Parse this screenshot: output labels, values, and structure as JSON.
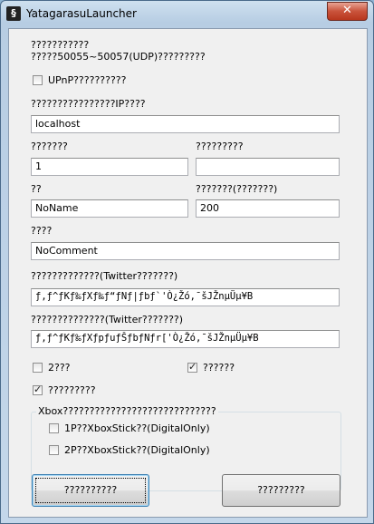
{
  "window": {
    "title": "YatagarasuLauncher",
    "close_label": "✕"
  },
  "labels": {
    "port_title": "???????????",
    "port_desc": "?????50055~50057(UDP)?????????",
    "upnp": "UPnP??????????",
    "ip_label": "????????????????IP????",
    "port_left_label": "???????",
    "port_right_label": "?????????",
    "name_label": "??",
    "delay_label": "???????(???????)",
    "comment_label": "????",
    "twitter_id_label": "?????????????(Twitter???????)",
    "twitter_pw_label": "??????????????(Twitter???????)",
    "opt1": "2???",
    "opt2": "??????",
    "opt3": "?????????",
    "xbox_group": "Xbox?????????????????????????????",
    "xbox_1p": "1P??XboxStick??(DigitalOnly)",
    "xbox_2p": "2P??XboxStick??(DigitalOnly)"
  },
  "fields": {
    "ip": "localhost",
    "port_left": "1",
    "port_right": "",
    "name": "NoName",
    "delay": "200",
    "comment": "NoComment",
    "twitter_id": "ƒ‚ƒ^ƒKƒ‰ƒXƒ‰ƒ“ƒNƒ|ƒbƒ`'Ò¿Žó‚¯šJŽnµÜµ¥B",
    "twitter_pw": "ƒ‚ƒ^ƒKƒ‰ƒXƒpƒuƒŠƒbƒNƒr['Ò¿Žó‚¯šJŽnµÜµ¥B"
  },
  "checks": {
    "upnp": false,
    "opt1": false,
    "opt2": true,
    "opt3": true,
    "xbox_1p": false,
    "xbox_2p": false
  },
  "buttons": {
    "ok": "??????????",
    "cancel": "?????????"
  }
}
